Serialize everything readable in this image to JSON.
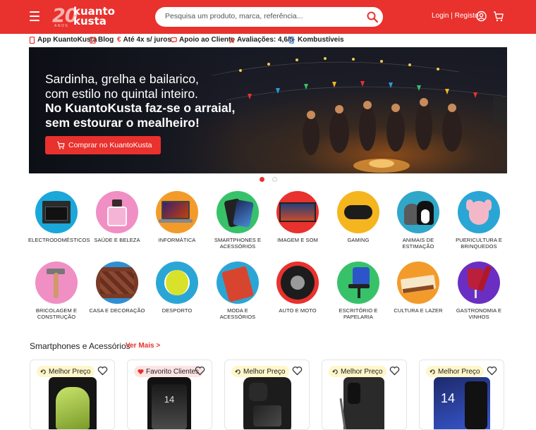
{
  "header": {
    "logo_number": "20",
    "logo_sub": "ANOS",
    "logo_line1": "kuanto",
    "logo_line2": "kusta",
    "search_placeholder": "Pesquisa um produto, marca, referência...",
    "login_label": "Login | Registo",
    "brand_color": "#e9312d"
  },
  "subnav": [
    {
      "label": "App KuantoKusta",
      "icon": "phone-icon"
    },
    {
      "label": "Blog",
      "icon": "book-icon"
    },
    {
      "label": "Até 4x s/ juros",
      "icon": "euro-icon"
    },
    {
      "label": "Apoio ao Cliente",
      "icon": "chat-icon"
    },
    {
      "label": "Avaliações: 4,6/5",
      "icon": "star-icon"
    },
    {
      "label": "Kombustíveis",
      "icon": "fuel-icon"
    }
  ],
  "banner": {
    "line1": "Sardinha, grelha e bailarico,",
    "line2": "com estilo no quintal inteiro.",
    "line3": "No KuantoKusta faz-se o arraial,",
    "line4": "sem estourar o mealheiro!",
    "cta": "Comprar no KuantoKusta"
  },
  "categories_row1": [
    {
      "label": "ELECTRODOMÉSTICOS",
      "icon": "oven-icon",
      "bg": "#1aa7d9"
    },
    {
      "label": "SAÚDE E BELEZA",
      "icon": "perfume-icon",
      "bg": "#f08fc4"
    },
    {
      "label": "INFORMÁTICA",
      "icon": "laptop-icon",
      "bg": "#f39b2a"
    },
    {
      "label": "SMARTPHONES E ACESSÓRIOS",
      "icon": "smartphone-icon",
      "bg": "#37c26a"
    },
    {
      "label": "IMAGEM E SOM",
      "icon": "tv-icon",
      "bg": "#e9312d"
    },
    {
      "label": "GAMING",
      "icon": "gamepad-icon",
      "bg": "#f5b51e"
    },
    {
      "label": "ANIMAIS DE ESTIMAÇÃO",
      "icon": "pets-icon",
      "bg": "#2fa7c9"
    },
    {
      "label": "PUERICULTURA E BRINQUEDOS",
      "icon": "plush-icon",
      "bg": "#2aa6d6"
    }
  ],
  "categories_row2": [
    {
      "label": "BRICOLAGEM E CONSTRUÇÃO",
      "icon": "hammer-icon",
      "bg": "#f08fc4"
    },
    {
      "label": "CASA E DECORAÇÃO",
      "icon": "furniture-icon",
      "bg": "#2f8fd3"
    },
    {
      "label": "DESPORTO",
      "icon": "tennis-ball-icon",
      "bg": "#2aa6d6"
    },
    {
      "label": "MODA E ACESSÓRIOS",
      "icon": "shirt-icon",
      "bg": "#2aa6d6"
    },
    {
      "label": "AUTO E MOTO",
      "icon": "tire-icon",
      "bg": "#e9312d"
    },
    {
      "label": "ESCRITÓRIO E PAPELARIA",
      "icon": "office-chair-icon",
      "bg": "#37c26a"
    },
    {
      "label": "CULTURA E LAZER",
      "icon": "book-open-icon",
      "bg": "#f39b2a"
    },
    {
      "label": "GASTRONOMIA E VINHOS",
      "icon": "wine-icon",
      "bg": "#6a2fc2"
    }
  ],
  "section": {
    "title": "Smartphones e Acessórios",
    "more": "Ver Mais >"
  },
  "products": [
    {
      "badge": "Melhor Preço",
      "badge_type": "best-price"
    },
    {
      "badge": "Favorito Clientes",
      "badge_type": "favorite"
    },
    {
      "badge": "Melhor Preço",
      "badge_type": "best-price"
    },
    {
      "badge": "Melhor Preço",
      "badge_type": "best-price"
    },
    {
      "badge": "Melhor Preço",
      "badge_type": "best-price"
    }
  ],
  "phone_screen_text": "14"
}
